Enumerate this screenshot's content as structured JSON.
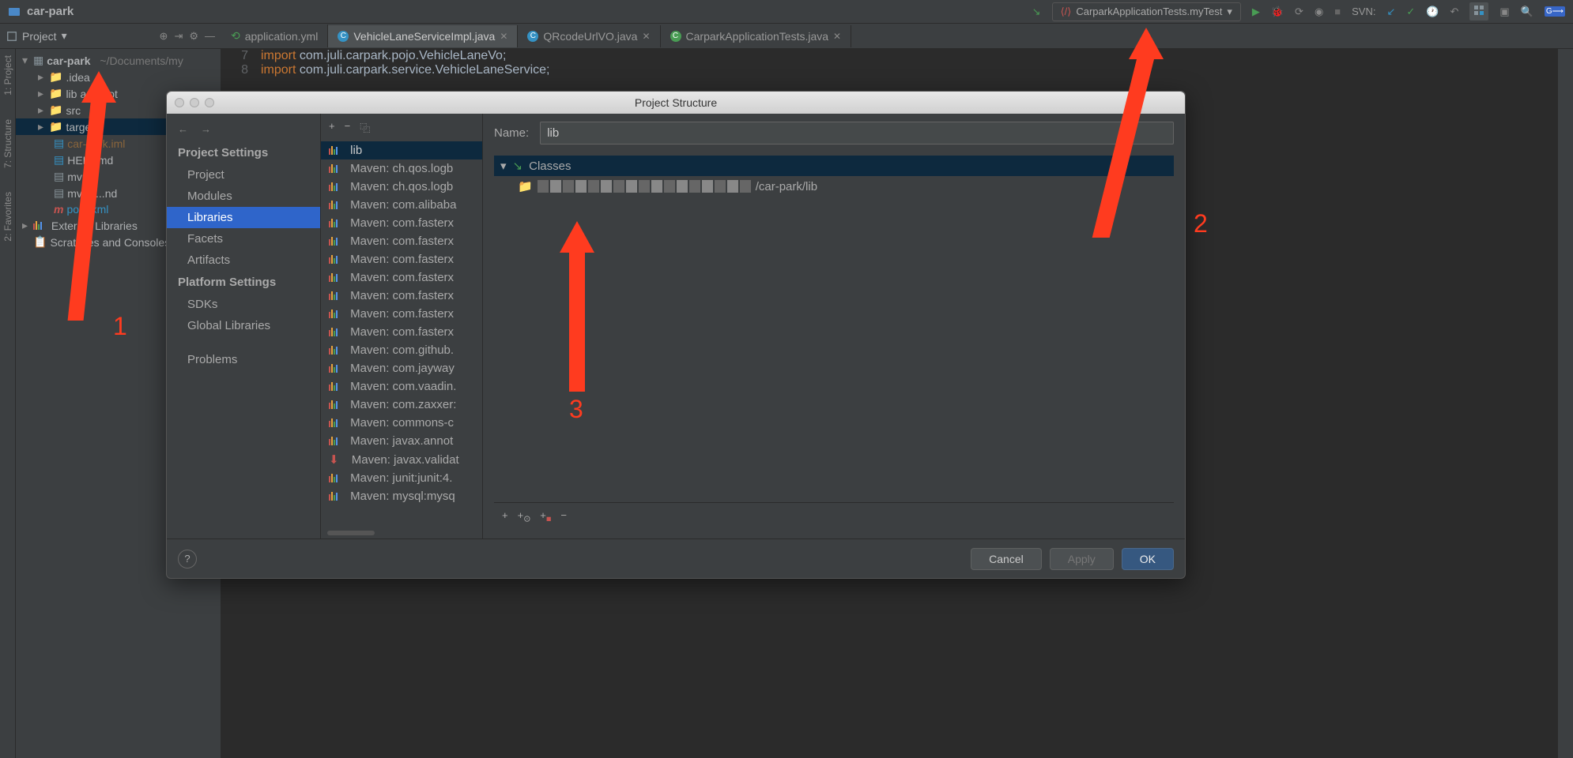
{
  "window": {
    "title": "car-park"
  },
  "toolbar": {
    "run_config": "CarparkApplicationTests.myTest",
    "svn_label": "SVN:"
  },
  "project_panel": {
    "button_label": "Project",
    "root": "car-park",
    "root_path": "~/Documents/my",
    "items": [
      {
        "label": ".idea",
        "kind": "folder"
      },
      {
        "label": "lib",
        "suffix": "ary root",
        "kind": "folder"
      },
      {
        "label": "src",
        "kind": "folder"
      },
      {
        "label": "target",
        "kind": "folder-orange",
        "selected": true
      },
      {
        "label": "car-park.iml",
        "kind": "file"
      },
      {
        "label": "HELP.md",
        "kind": "file"
      },
      {
        "label": "mvnw",
        "kind": "file"
      },
      {
        "label": "mvnw...nd",
        "kind": "file"
      },
      {
        "label": "pom.xml",
        "kind": "file-maven"
      }
    ],
    "external_libs": "External Libraries",
    "scratches": "Scratches and Consoles"
  },
  "tabs": [
    {
      "label": "application.yml",
      "kind": "yml"
    },
    {
      "label": "VehicleLaneServiceImpl.java",
      "kind": "class",
      "active": true
    },
    {
      "label": "QRcodeUrlVO.java",
      "kind": "class"
    },
    {
      "label": "CarparkApplicationTests.java",
      "kind": "class-run"
    }
  ],
  "editor": {
    "lines": [
      {
        "n": "7",
        "kw": "import",
        "rest": " com.juli.carpark.pojo.VehicleLaneVo;"
      },
      {
        "n": "8",
        "kw": "import",
        "rest": " com.juli.carpark.service.VehicleLaneService;"
      }
    ]
  },
  "dialog": {
    "title": "Project Structure",
    "sections": {
      "project_settings": "Project Settings",
      "project": "Project",
      "modules": "Modules",
      "libraries": "Libraries",
      "facets": "Facets",
      "artifacts": "Artifacts",
      "platform_settings": "Platform Settings",
      "sdks": "SDKs",
      "global_libraries": "Global Libraries",
      "problems": "Problems"
    },
    "libs": [
      "lib",
      "Maven: ch.qos.logb",
      "Maven: ch.qos.logb",
      "Maven: com.alibaba",
      "Maven: com.fasterx",
      "Maven: com.fasterx",
      "Maven: com.fasterx",
      "Maven: com.fasterx",
      "Maven: com.fasterx",
      "Maven: com.fasterx",
      "Maven: com.fasterx",
      "Maven: com.github.",
      "Maven: com.jayway",
      "Maven: com.vaadin.",
      "Maven: com.zaxxer:",
      "Maven: commons-c",
      "Maven: javax.annot",
      "Maven: javax.validat",
      "Maven: junit:junit:4.",
      "Maven: mysql:mysq"
    ],
    "name_label": "Name:",
    "name_value": "lib",
    "classes_label": "Classes",
    "path_suffix": "/car-park/lib",
    "buttons": {
      "cancel": "Cancel",
      "apply": "Apply",
      "ok": "OK"
    }
  },
  "annotations": {
    "a1": "1",
    "a2": "2",
    "a3": "3"
  },
  "side_tabs": {
    "project": "1: Project",
    "structure": "7: Structure",
    "favorites": "2: Favorites"
  }
}
